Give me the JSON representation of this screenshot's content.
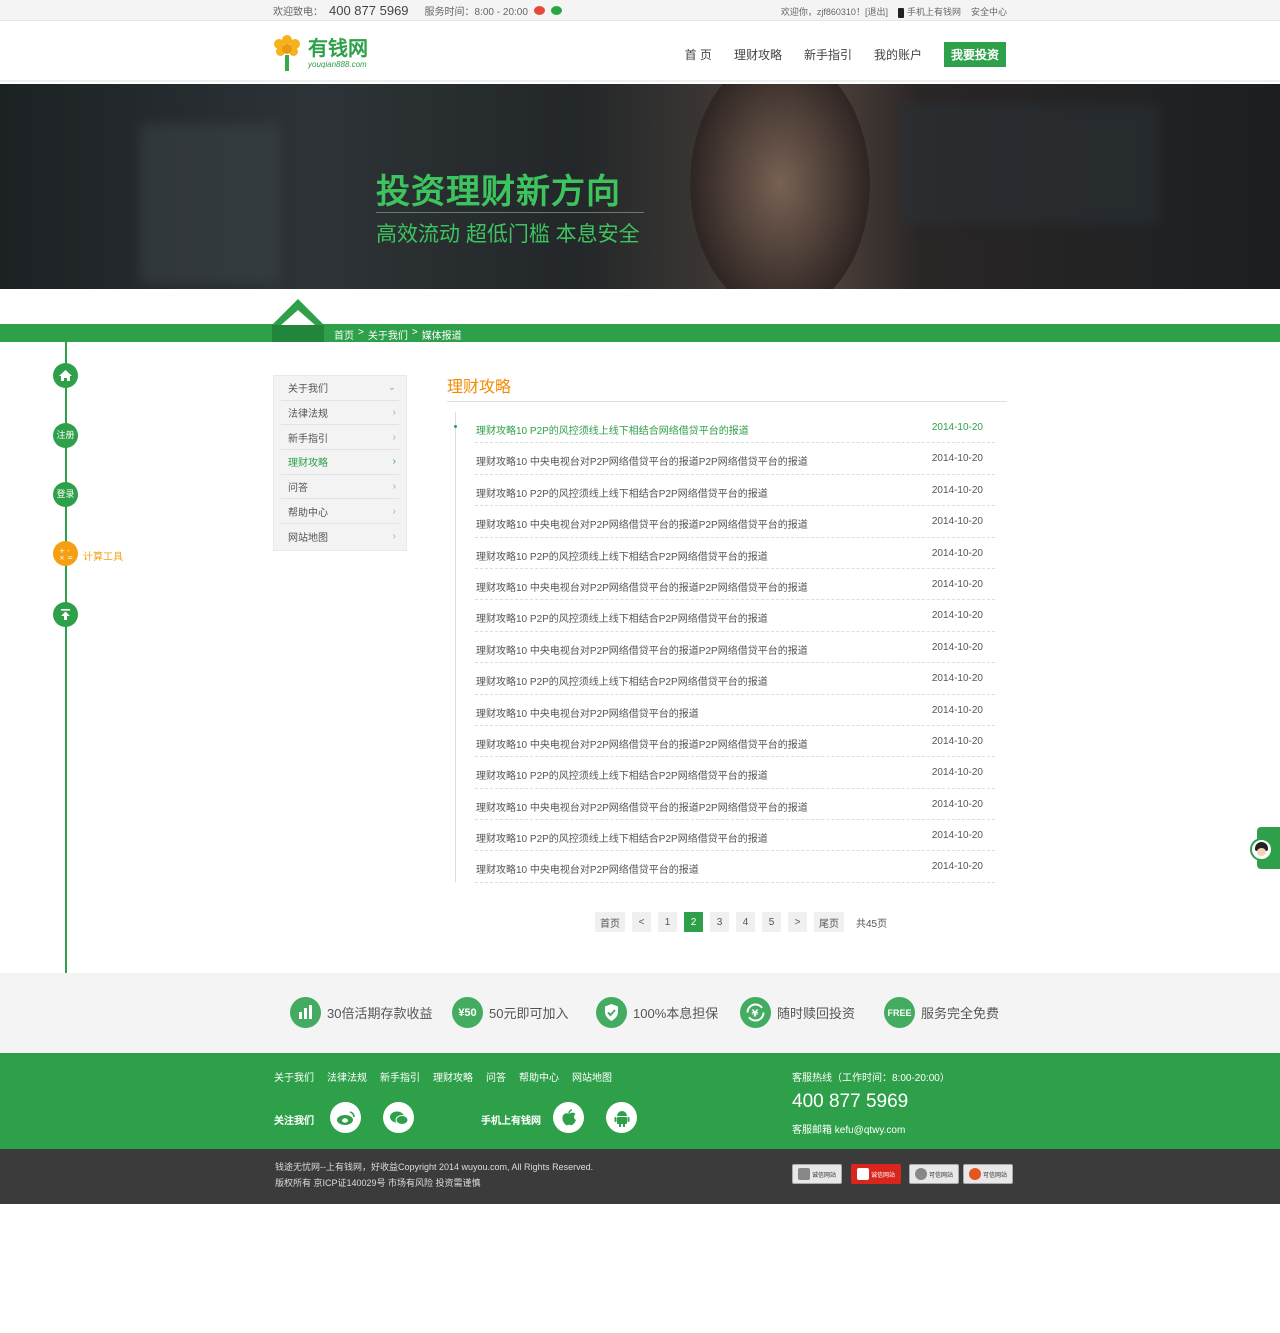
{
  "topbar": {
    "welcome_call": "欢迎致电：",
    "phone": "400 877 5969",
    "service_hours": "服务时间：8:00 - 20:00",
    "welcome_user": "欢迎你，zjf860310！",
    "logout": "[退出]",
    "mobile_site": "手机上有钱网",
    "security": "安全中心"
  },
  "header": {
    "logo_name": "有钱网",
    "logo_url": "youqian888.com",
    "nav": [
      "首 页",
      "理财攻略",
      "新手指引",
      "我的账户"
    ],
    "cta": "我要投资"
  },
  "banner": {
    "headline": "投资理财新方向",
    "subline": "高效流动  超低门槛  本息安全"
  },
  "breadcrumb": [
    "首页",
    ">",
    "关于我们",
    ">",
    "媒体报道"
  ],
  "timeline": {
    "items": [
      "注册",
      "登录"
    ],
    "active_label": "计算工具",
    "accent": "#f5a012"
  },
  "menu": {
    "items": [
      {
        "label": "关于我们",
        "icon": "chevron-down"
      },
      {
        "label": "法律法规",
        "icon": "chevron-right"
      },
      {
        "label": "新手指引",
        "icon": "chevron-right"
      },
      {
        "label": "理财攻略",
        "icon": "chevron-right",
        "active": true
      },
      {
        "label": "问答",
        "icon": "chevron-right"
      },
      {
        "label": "帮助中心",
        "icon": "chevron-right"
      },
      {
        "label": "网站地图",
        "icon": "chevron-right"
      }
    ]
  },
  "section": {
    "title": "理财攻略",
    "articles": [
      {
        "title": "理财攻略10 P2P的风控须线上线下相结合网络借贷平台的报道",
        "date": "2014-10-20"
      },
      {
        "title": "理财攻略10 中央电视台对P2P网络借贷平台的报道P2P网络借贷平台的报道",
        "date": "2014-10-20"
      },
      {
        "title": "理财攻略10 P2P的风控须线上线下相结合P2P网络借贷平台的报道",
        "date": "2014-10-20"
      },
      {
        "title": "理财攻略10 中央电视台对P2P网络借贷平台的报道P2P网络借贷平台的报道",
        "date": "2014-10-20"
      },
      {
        "title": "理财攻略10 P2P的风控须线上线下相结合P2P网络借贷平台的报道",
        "date": "2014-10-20"
      },
      {
        "title": "理财攻略10 中央电视台对P2P网络借贷平台的报道P2P网络借贷平台的报道",
        "date": "2014-10-20"
      },
      {
        "title": "理财攻略10 P2P的风控须线上线下相结合P2P网络借贷平台的报道",
        "date": "2014-10-20"
      },
      {
        "title": "理财攻略10 中央电视台对P2P网络借贷平台的报道P2P网络借贷平台的报道",
        "date": "2014-10-20"
      },
      {
        "title": "理财攻略10 P2P的风控须线上线下相结合P2P网络借贷平台的报道",
        "date": "2014-10-20"
      },
      {
        "title": "理财攻略10 中央电视台对P2P网络借贷平台的报道",
        "date": "2014-10-20"
      },
      {
        "title": "理财攻略10 中央电视台对P2P网络借贷平台的报道P2P网络借贷平台的报道",
        "date": "2014-10-20"
      },
      {
        "title": "理财攻略10 P2P的风控须线上线下相结合P2P网络借贷平台的报道",
        "date": "2014-10-20"
      },
      {
        "title": "理财攻略10 中央电视台对P2P网络借贷平台的报道P2P网络借贷平台的报道",
        "date": "2014-10-20"
      },
      {
        "title": "理财攻略10 P2P的风控须线上线下相结合P2P网络借贷平台的报道",
        "date": "2014-10-20"
      },
      {
        "title": "理财攻略10 中央电视台对P2P网络借贷平台的报道",
        "date": "2014-10-20"
      }
    ]
  },
  "pager": {
    "first": "首页",
    "pages": [
      "1",
      "2",
      "3",
      "4",
      "5"
    ],
    "current": "2",
    "last": "尾页",
    "total": "共45页"
  },
  "features": [
    {
      "icon": "bar-chart-icon",
      "label": "30倍活期存款收益"
    },
    {
      "icon_text": "¥50",
      "label": "50元即可加入"
    },
    {
      "icon": "shield-check-icon",
      "label": "100%本息担保"
    },
    {
      "icon": "yen-refresh-icon",
      "label": "随时赎回投资"
    },
    {
      "icon_text": "FREE",
      "label": "服务完全免费"
    }
  ],
  "footer": {
    "links": [
      "关于我们",
      "法律法规",
      "新手指引",
      "理财攻略",
      "问答",
      "帮助中心",
      "网站地图"
    ],
    "follow": "关注我们",
    "mobile": "手机上有钱网",
    "hotline_label": "客服热线（工作时间：8:00-20:00）",
    "hotline": "400 877 5969",
    "email": "客服邮箱 kefu@qtwy.com",
    "copyright": "钱途无忧网--上有钱网，好收益Copyright 2014 wuyou.com, All Rights Reserved.",
    "icp": "版权所有 京ICP证140029号 市场有风险 投资需谨慎",
    "certs": [
      "诚信网站",
      "诚信网站",
      "可信网站",
      "可信网站"
    ]
  },
  "colors": {
    "brand": "#2ea04a",
    "accent": "#f08c00"
  }
}
